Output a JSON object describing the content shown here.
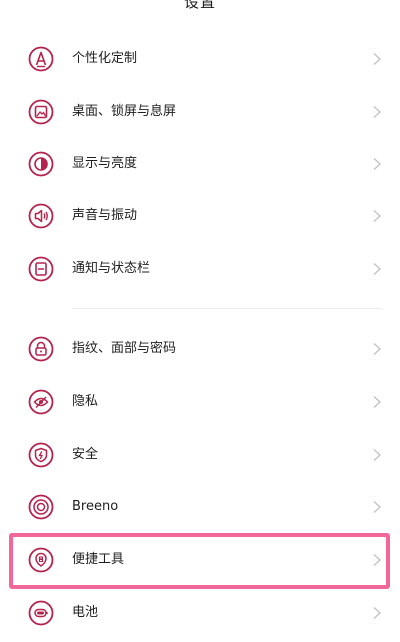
{
  "header": {
    "title": "设置"
  },
  "colors": {
    "accent": "#b5234d",
    "highlight": "#f2679a",
    "chevron": "#c4c4c4"
  },
  "settings": {
    "items": [
      {
        "label": "个性化定制",
        "icon": "personalization-icon"
      },
      {
        "label": "桌面、锁屏与息屏",
        "icon": "wallpaper-icon"
      },
      {
        "label": "显示与亮度",
        "icon": "display-brightness-icon"
      },
      {
        "label": "声音与振动",
        "icon": "sound-icon"
      },
      {
        "label": "通知与状态栏",
        "icon": "notification-icon"
      },
      {
        "label": "指纹、面部与密码",
        "icon": "lock-icon"
      },
      {
        "label": "隐私",
        "icon": "privacy-eye-icon"
      },
      {
        "label": "安全",
        "icon": "shield-icon"
      },
      {
        "label": "Breeno",
        "icon": "breeno-icon"
      },
      {
        "label": "便捷工具",
        "icon": "convenience-tools-icon"
      },
      {
        "label": "电池",
        "icon": "battery-icon"
      }
    ]
  }
}
